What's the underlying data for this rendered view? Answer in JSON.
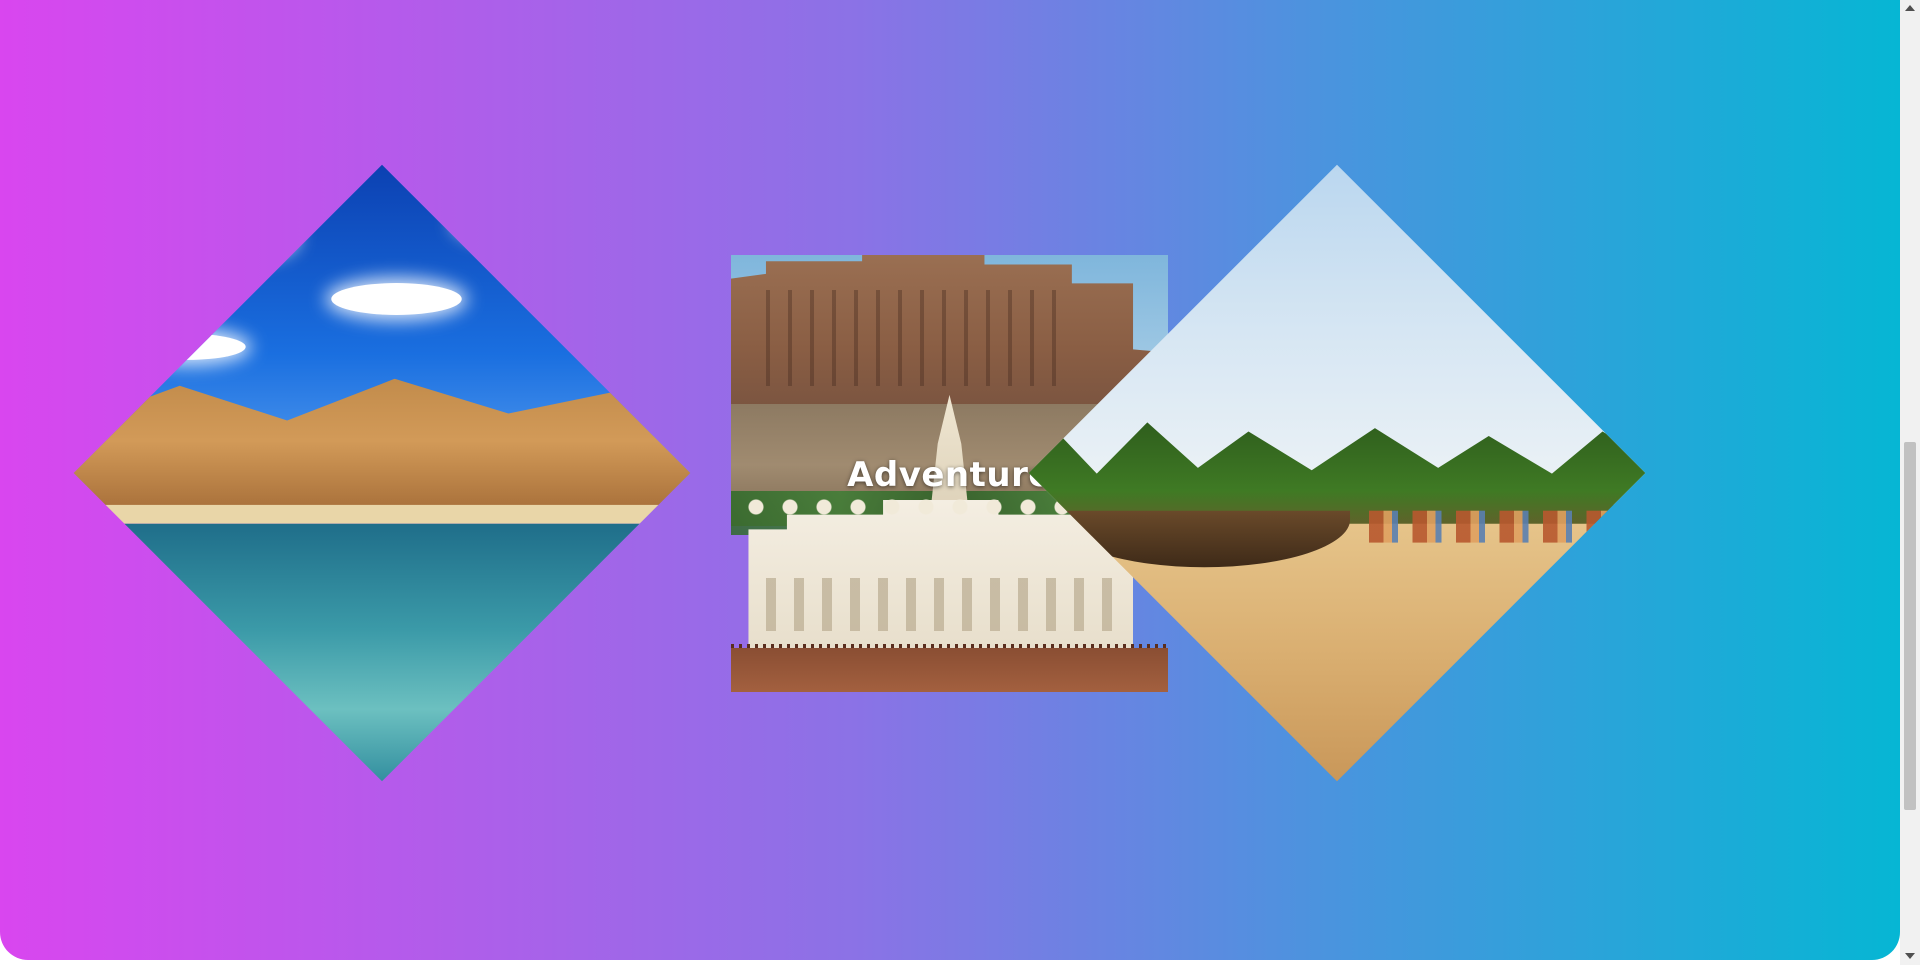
{
  "gallery": {
    "center_title": "Adventure",
    "cards": [
      {
        "scene": "mountain-lake"
      },
      {
        "scene": "fort-and-palace"
      },
      {
        "scene": "palm-beach"
      }
    ]
  },
  "colors": {
    "gradient_start": "#d946ef",
    "gradient_end": "#06b6d4"
  }
}
